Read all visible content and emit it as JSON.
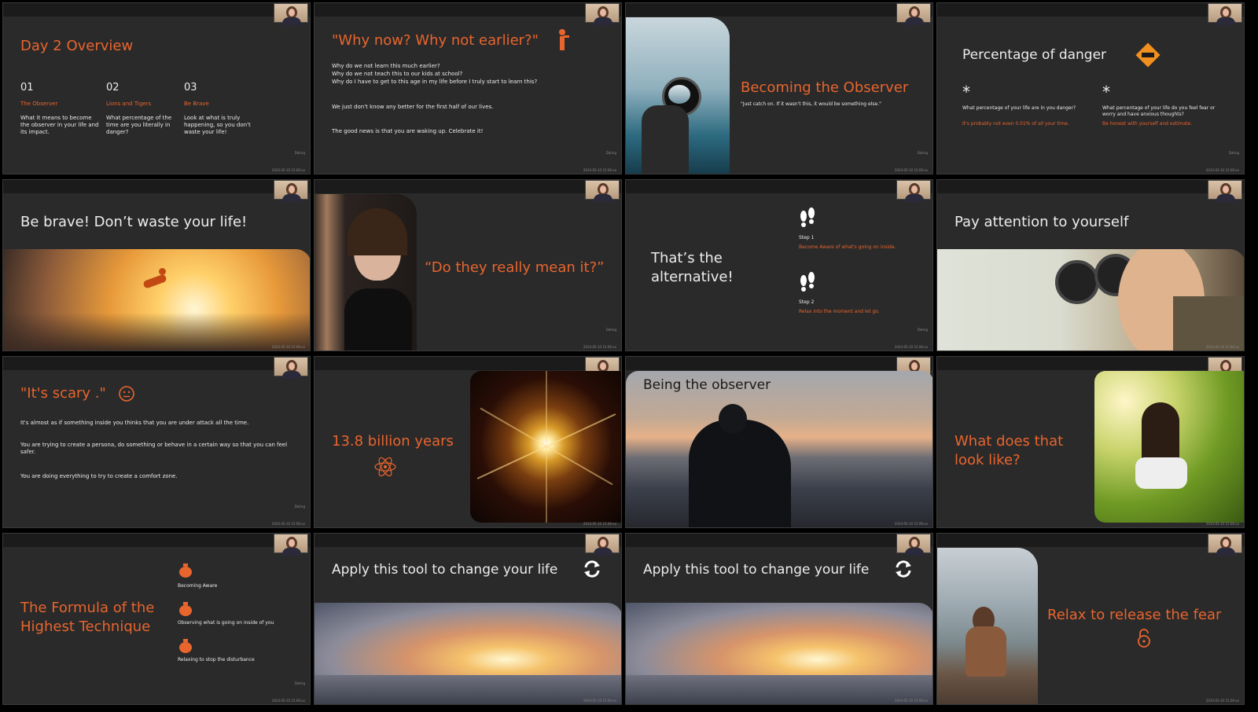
{
  "footer_text": "2024-05-10 15:06:xx",
  "brand_text": "Dating",
  "slides": {
    "s1": {
      "title": "Day 2 Overview",
      "cols": [
        {
          "num": "01",
          "head": "The Observer",
          "text": "What it means to become the observer in your life and its impact."
        },
        {
          "num": "02",
          "head": "Lions and Tigers",
          "text": "What percentage of the time are you literally in danger?"
        },
        {
          "num": "03",
          "head": "Be Brave",
          "text": "Look at what is truly happening, so you don't waste your life!"
        }
      ]
    },
    "s2": {
      "title": "\"Why now? Why not earlier?\"",
      "lines": [
        "Why do we not learn this much earlier?",
        "Why do we not teach this to our kids at school?",
        "Why do I have to get to this age in my life before I truly start to learn this?"
      ],
      "p2": "We just don't know any better for the first half of our lives.",
      "p3": "The good news is that you are waking up. Celebrate it!"
    },
    "s3": {
      "title": "Becoming the Observer",
      "quote": "\"Just catch on. If it wasn't this, it would be something else.\""
    },
    "s4": {
      "title": "Percentage of danger",
      "badge": "DANGER",
      "c1_text": "What percentage of your life are in you danger?",
      "c1_note": "It's probably not even 0.01% of all your time.",
      "c2_text": "What percentage of your life do you feel fear or worry and have anxious thoughts?",
      "c2_note": "Be honest with yourself and estimate."
    },
    "s5": {
      "title": "Be brave! Don’t waste your life!"
    },
    "s6": {
      "title": "“Do they really mean it?”"
    },
    "s7": {
      "title_l1": "That’s the",
      "title_l2": "alternative!",
      "step1": "Step 1",
      "step1_text": "Become Aware of what's going on inside.",
      "step2": "Step 2",
      "step2_text": "Relax into the moment and let go."
    },
    "s8": {
      "title": "Pay attention to yourself"
    },
    "s9": {
      "title": "\"It's scary .\"",
      "p1": "It's almost as if something inside you thinks that you are under attack all the time.",
      "p2": "You are trying to create a persona, do something or behave in a certain way so that you can feel safer.",
      "p3": "You are doing everything to try to create a comfort zone."
    },
    "s10": {
      "title": "13.8 billion years"
    },
    "s11": {
      "title": "Being the observer"
    },
    "s12": {
      "title_l1": "What does that",
      "title_l2": "look like?"
    },
    "s13": {
      "title_l1": "The Formula of the",
      "title_l2": "Highest Technique",
      "items": [
        "Becoming Aware",
        "Observing what is going on inside of you",
        "Relaxing to stop the disturbance"
      ]
    },
    "s14": {
      "title": "Apply this tool to change your life"
    },
    "s15": {
      "title": "Apply this tool to change your life"
    },
    "s16": {
      "title": "Relax to release the fear"
    }
  },
  "icons": [
    "person-icon",
    "danger-sign-icon",
    "asterisk-icon",
    "footprints-icon",
    "neutral-face-icon",
    "atom-icon",
    "vase-icon",
    "refresh-icon",
    "lock-icon"
  ],
  "colors": {
    "accent": "#e8652e",
    "slide_bg": "#2a2a2a",
    "text": "#ececec"
  }
}
